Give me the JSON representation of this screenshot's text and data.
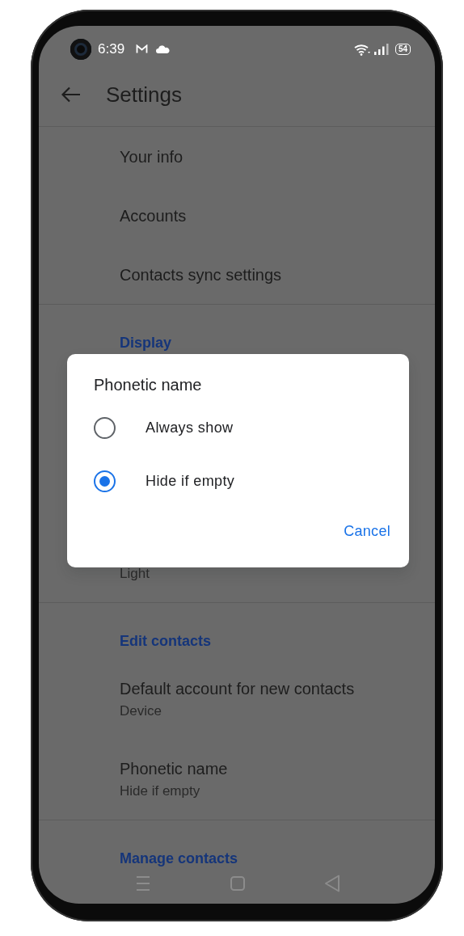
{
  "status_bar": {
    "time": "6:39",
    "battery": "54"
  },
  "app_bar": {
    "title": "Settings"
  },
  "items": [
    {
      "title": "Your info"
    },
    {
      "title": "Accounts"
    },
    {
      "title": "Contacts sync settings"
    }
  ],
  "sections": [
    {
      "header": "Display",
      "items": [
        {
          "subtitle": "Light"
        }
      ]
    },
    {
      "header": "Edit contacts",
      "items": [
        {
          "title": "Default account for new contacts",
          "subtitle": "Device"
        },
        {
          "title": "Phonetic name",
          "subtitle": "Hide if empty"
        }
      ]
    },
    {
      "header": "Manage contacts"
    }
  ],
  "dialog": {
    "title": "Phonetic name",
    "options": [
      {
        "label": "Always show",
        "selected": false
      },
      {
        "label": "Hide if empty",
        "selected": true
      }
    ],
    "buttons": [
      "Cancel"
    ]
  }
}
